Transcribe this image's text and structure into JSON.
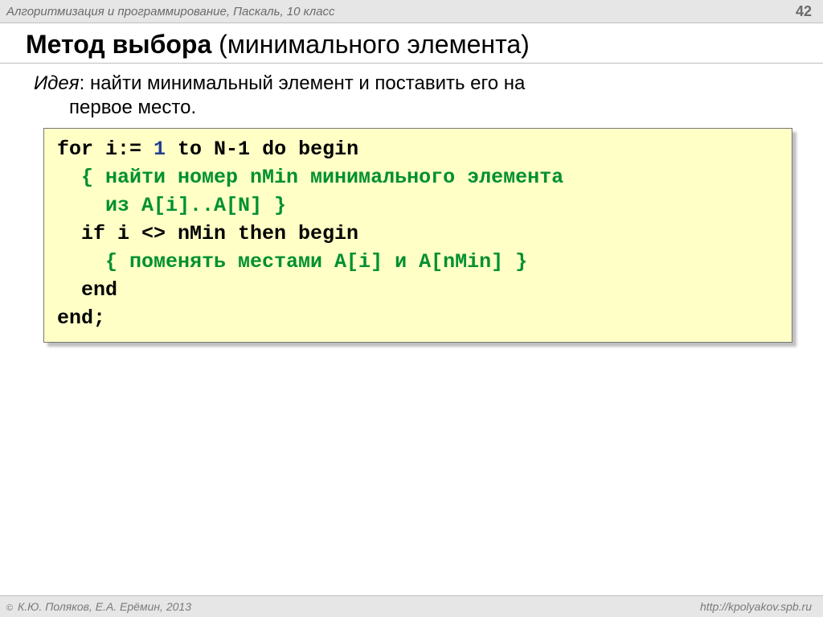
{
  "header": {
    "left": "Алгоритмизация и программирование, Паскаль, 10 класс",
    "page": "42"
  },
  "title": {
    "bold": "Метод выбора",
    "rest": " (минимального элемента)"
  },
  "idea": {
    "label": "Идея",
    "line1": ": найти минимальный элемент и поставить его на",
    "line2": "первое место."
  },
  "code": {
    "l1a": "for i:= ",
    "l1b": "1",
    "l1c": " to N-1 do begin",
    "l2": "  { найти номер nMin минимального элемента",
    "l3": "    из A[i]..A[N] }",
    "l4": "  if i <> nMin then begin",
    "l5": "    { поменять местами A[i] и A[nMin] }",
    "l6": "  end",
    "l7": "end;"
  },
  "footer": {
    "copyright": " К.Ю. Поляков, Е.А. Ерёмин, 2013",
    "url": "http://kpolyakov.spb.ru"
  }
}
